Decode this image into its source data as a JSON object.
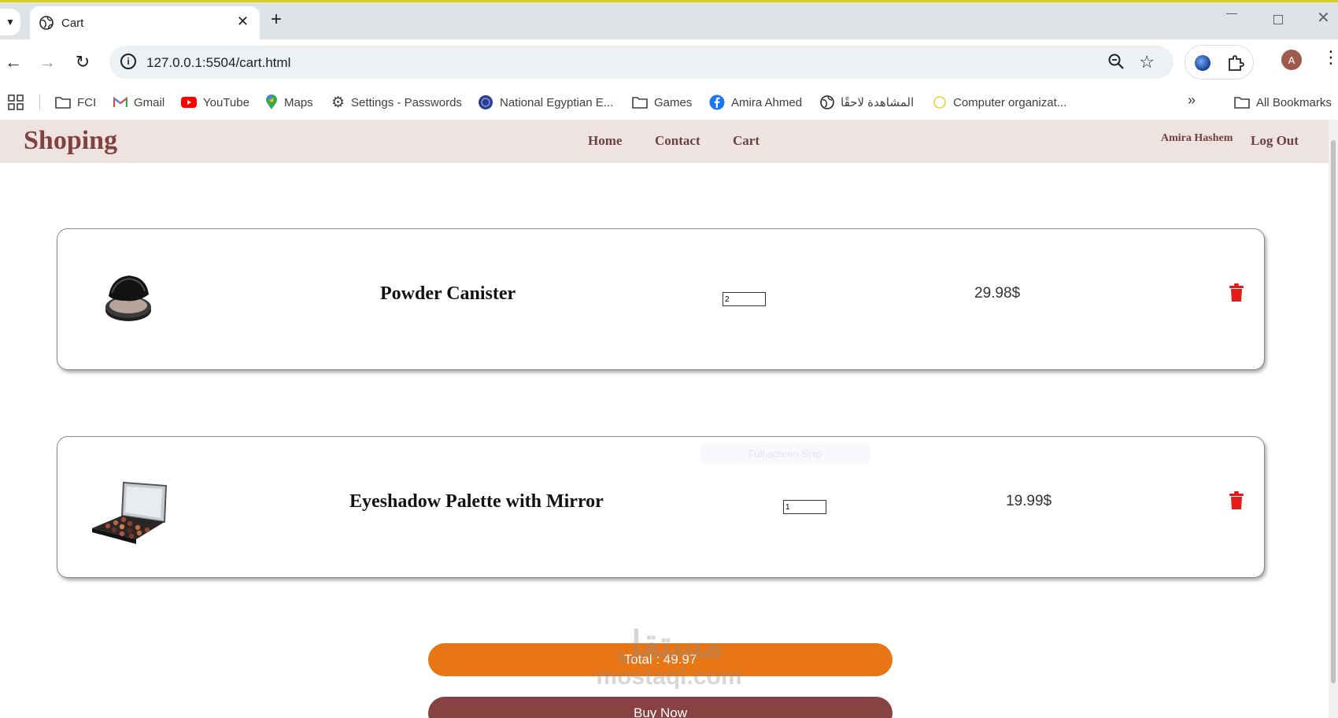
{
  "browser": {
    "tab_title": "Cart",
    "url": "127.0.0.1:5504/cart.html",
    "avatar_letter": "A",
    "bookmarks": [
      {
        "label": "FCI",
        "icon": "folder-icon"
      },
      {
        "label": "Gmail",
        "icon": "gmail-icon"
      },
      {
        "label": "YouTube",
        "icon": "youtube-icon"
      },
      {
        "label": "Maps",
        "icon": "maps-icon"
      },
      {
        "label": "Settings - Passwords",
        "icon": "gear-icon"
      },
      {
        "label": "National Egyptian E...",
        "icon": "globe-icon"
      },
      {
        "label": "Games",
        "icon": "folder-icon"
      },
      {
        "label": "Amira Ahmed",
        "icon": "facebook-icon"
      },
      {
        "label": "المشاهدة لاحقًا",
        "icon": "globe-icon"
      },
      {
        "label": "Computer organizat...",
        "icon": "loading-icon"
      }
    ],
    "all_bookmarks_label": "All Bookmarks"
  },
  "site": {
    "brand": "Shoping",
    "nav": {
      "home": "Home",
      "contact": "Contact",
      "cart": "Cart"
    },
    "user_name": "Amira Hashem",
    "logout": "Log Out"
  },
  "cart": {
    "items": [
      {
        "name": "Powder Canister",
        "quantity": "2",
        "price": "29.98$",
        "image": "powder-canister-image"
      },
      {
        "name": "Eyeshadow Palette with Mirror",
        "quantity": "1",
        "price": "19.99$",
        "image": "eyeshadow-palette-image"
      }
    ],
    "total_label": "Total : 49.97",
    "buy_label": "Buy Now"
  },
  "overlay": {
    "snip_hint": "Full-screen Snip",
    "watermark_ar": "مستقل",
    "watermark_en": "mostaql.com"
  },
  "colors": {
    "brand": "#82423f",
    "nav_bg": "#eee3e1",
    "total_bg": "#e87614",
    "buy_bg": "#874341",
    "delete": "#e41b1b"
  }
}
